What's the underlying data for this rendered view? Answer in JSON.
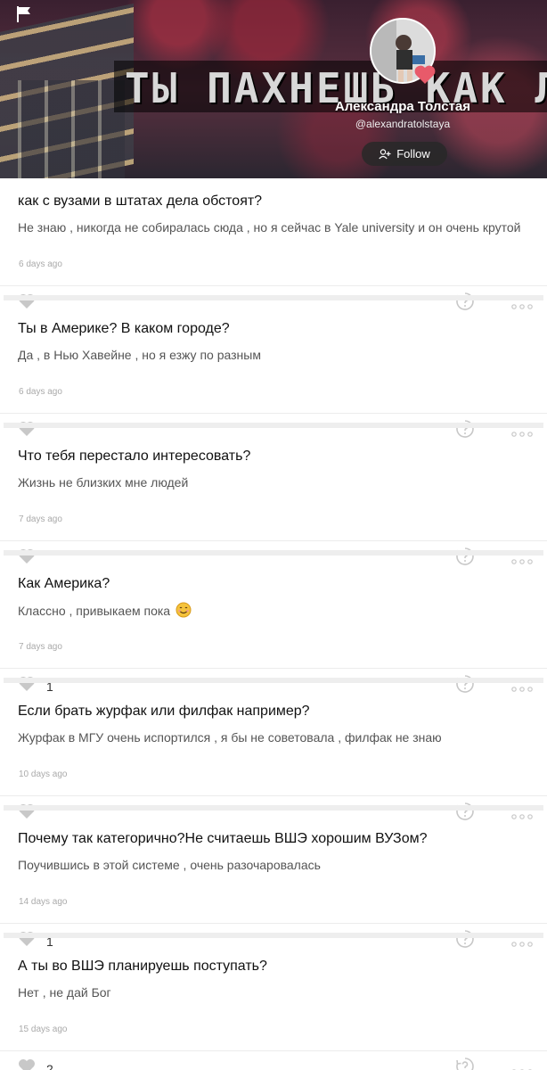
{
  "header": {
    "banner_text": "ТЫ ПАХНЕШЬ КАК ЛЮ",
    "name": "Александра Толстая",
    "handle": "@alexandratolstaya",
    "follow_label": "Follow"
  },
  "feed": [
    {
      "question": "как с вузами в штатах дела обстоят?",
      "answer": "Не знаю , никогда не собиралась сюда , но я сейчас в Yale university и он очень крутой",
      "time": "6 days ago",
      "likes": ""
    },
    {
      "question": "Ты в Америке? В каком городе?",
      "answer": "Да , в Нью Хавейне , но я езжу по разным",
      "time": "6 days ago",
      "likes": ""
    },
    {
      "question": "Что тебя перестало интересовать?",
      "answer": "Жизнь не близких мне людей",
      "time": "7 days ago",
      "likes": ""
    },
    {
      "question": "Как Америка?",
      "answer": "Классно , привыкаем пока",
      "answer_emoji": "smiling-face-emoji",
      "time": "7 days ago",
      "likes": "1"
    },
    {
      "question": "Если брать журфак или филфак например?",
      "answer": "Журфак в МГУ очень испортился , я бы не советовала , филфак не знаю",
      "time": "10 days ago",
      "likes": ""
    },
    {
      "question": "Почему так категорично?Не считаешь ВШЭ хорошим ВУЗом?",
      "answer": "Поучившись в этой системе , очень разочаровалась",
      "time": "14 days ago",
      "likes": "1"
    },
    {
      "question": "А ты во ВШЭ планируешь поступать?",
      "answer": "Нет , не дай Бог",
      "time": "15 days ago",
      "likes": "2"
    }
  ],
  "icons": {
    "flag": "flag-icon",
    "like": "heart-icon",
    "help": "question-bubble-icon",
    "more": "more-dots-icon"
  },
  "colors": {
    "icon_gray": "#c8c8c8",
    "divider": "#eeeeee",
    "heart_badge": "#e85a6a"
  }
}
